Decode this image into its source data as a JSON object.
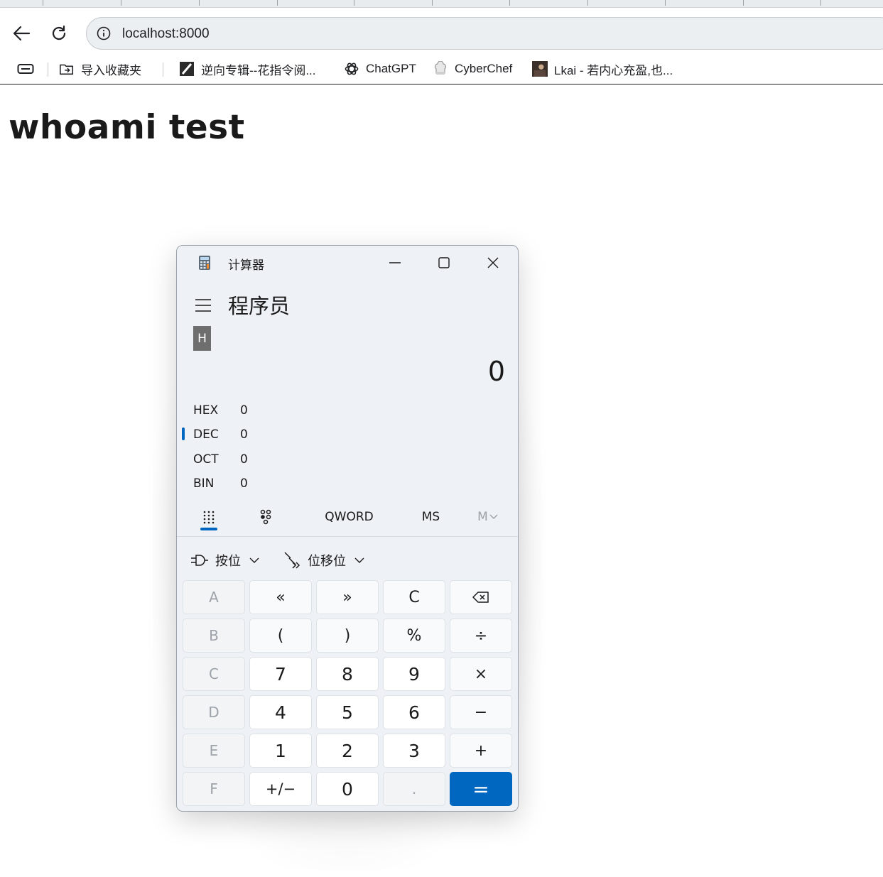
{
  "browser": {
    "url": "localhost:8000",
    "bookmarks": [
      {
        "label": "导入收藏夹",
        "icon": "import-icon"
      },
      {
        "label": "逆向专辑--花指令阅...",
        "icon": "zhihu-like-icon"
      },
      {
        "label": "ChatGPT",
        "icon": "openai-icon"
      },
      {
        "label": "CyberChef",
        "icon": "chef-icon"
      },
      {
        "label": "Lkai - 若内心充盈,也...",
        "icon": "avatar-icon"
      }
    ]
  },
  "page": {
    "heading": "whoami test"
  },
  "calculator": {
    "title": "计算器",
    "mode": "程序员",
    "badge": "H",
    "display": "0",
    "bases": [
      {
        "name": "HEX",
        "value": "0"
      },
      {
        "name": "DEC",
        "value": "0"
      },
      {
        "name": "OCT",
        "value": "0"
      },
      {
        "name": "BIN",
        "value": "0"
      }
    ],
    "active_base": "DEC",
    "word_size": "QWORD",
    "memory_store": "MS",
    "memory_list": "M",
    "bitwise_label": "按位",
    "bitshift_label": "位移位",
    "keys": [
      [
        "A",
        "«",
        "»",
        "C",
        "⌫"
      ],
      [
        "B",
        "(",
        ")",
        "%",
        "÷"
      ],
      [
        "C",
        "7",
        "8",
        "9",
        "×"
      ],
      [
        "D",
        "4",
        "5",
        "6",
        "−"
      ],
      [
        "E",
        "1",
        "2",
        "3",
        "+"
      ],
      [
        "F",
        "+/−",
        "0",
        ".",
        "="
      ]
    ],
    "accent_color": "#0067c0"
  }
}
